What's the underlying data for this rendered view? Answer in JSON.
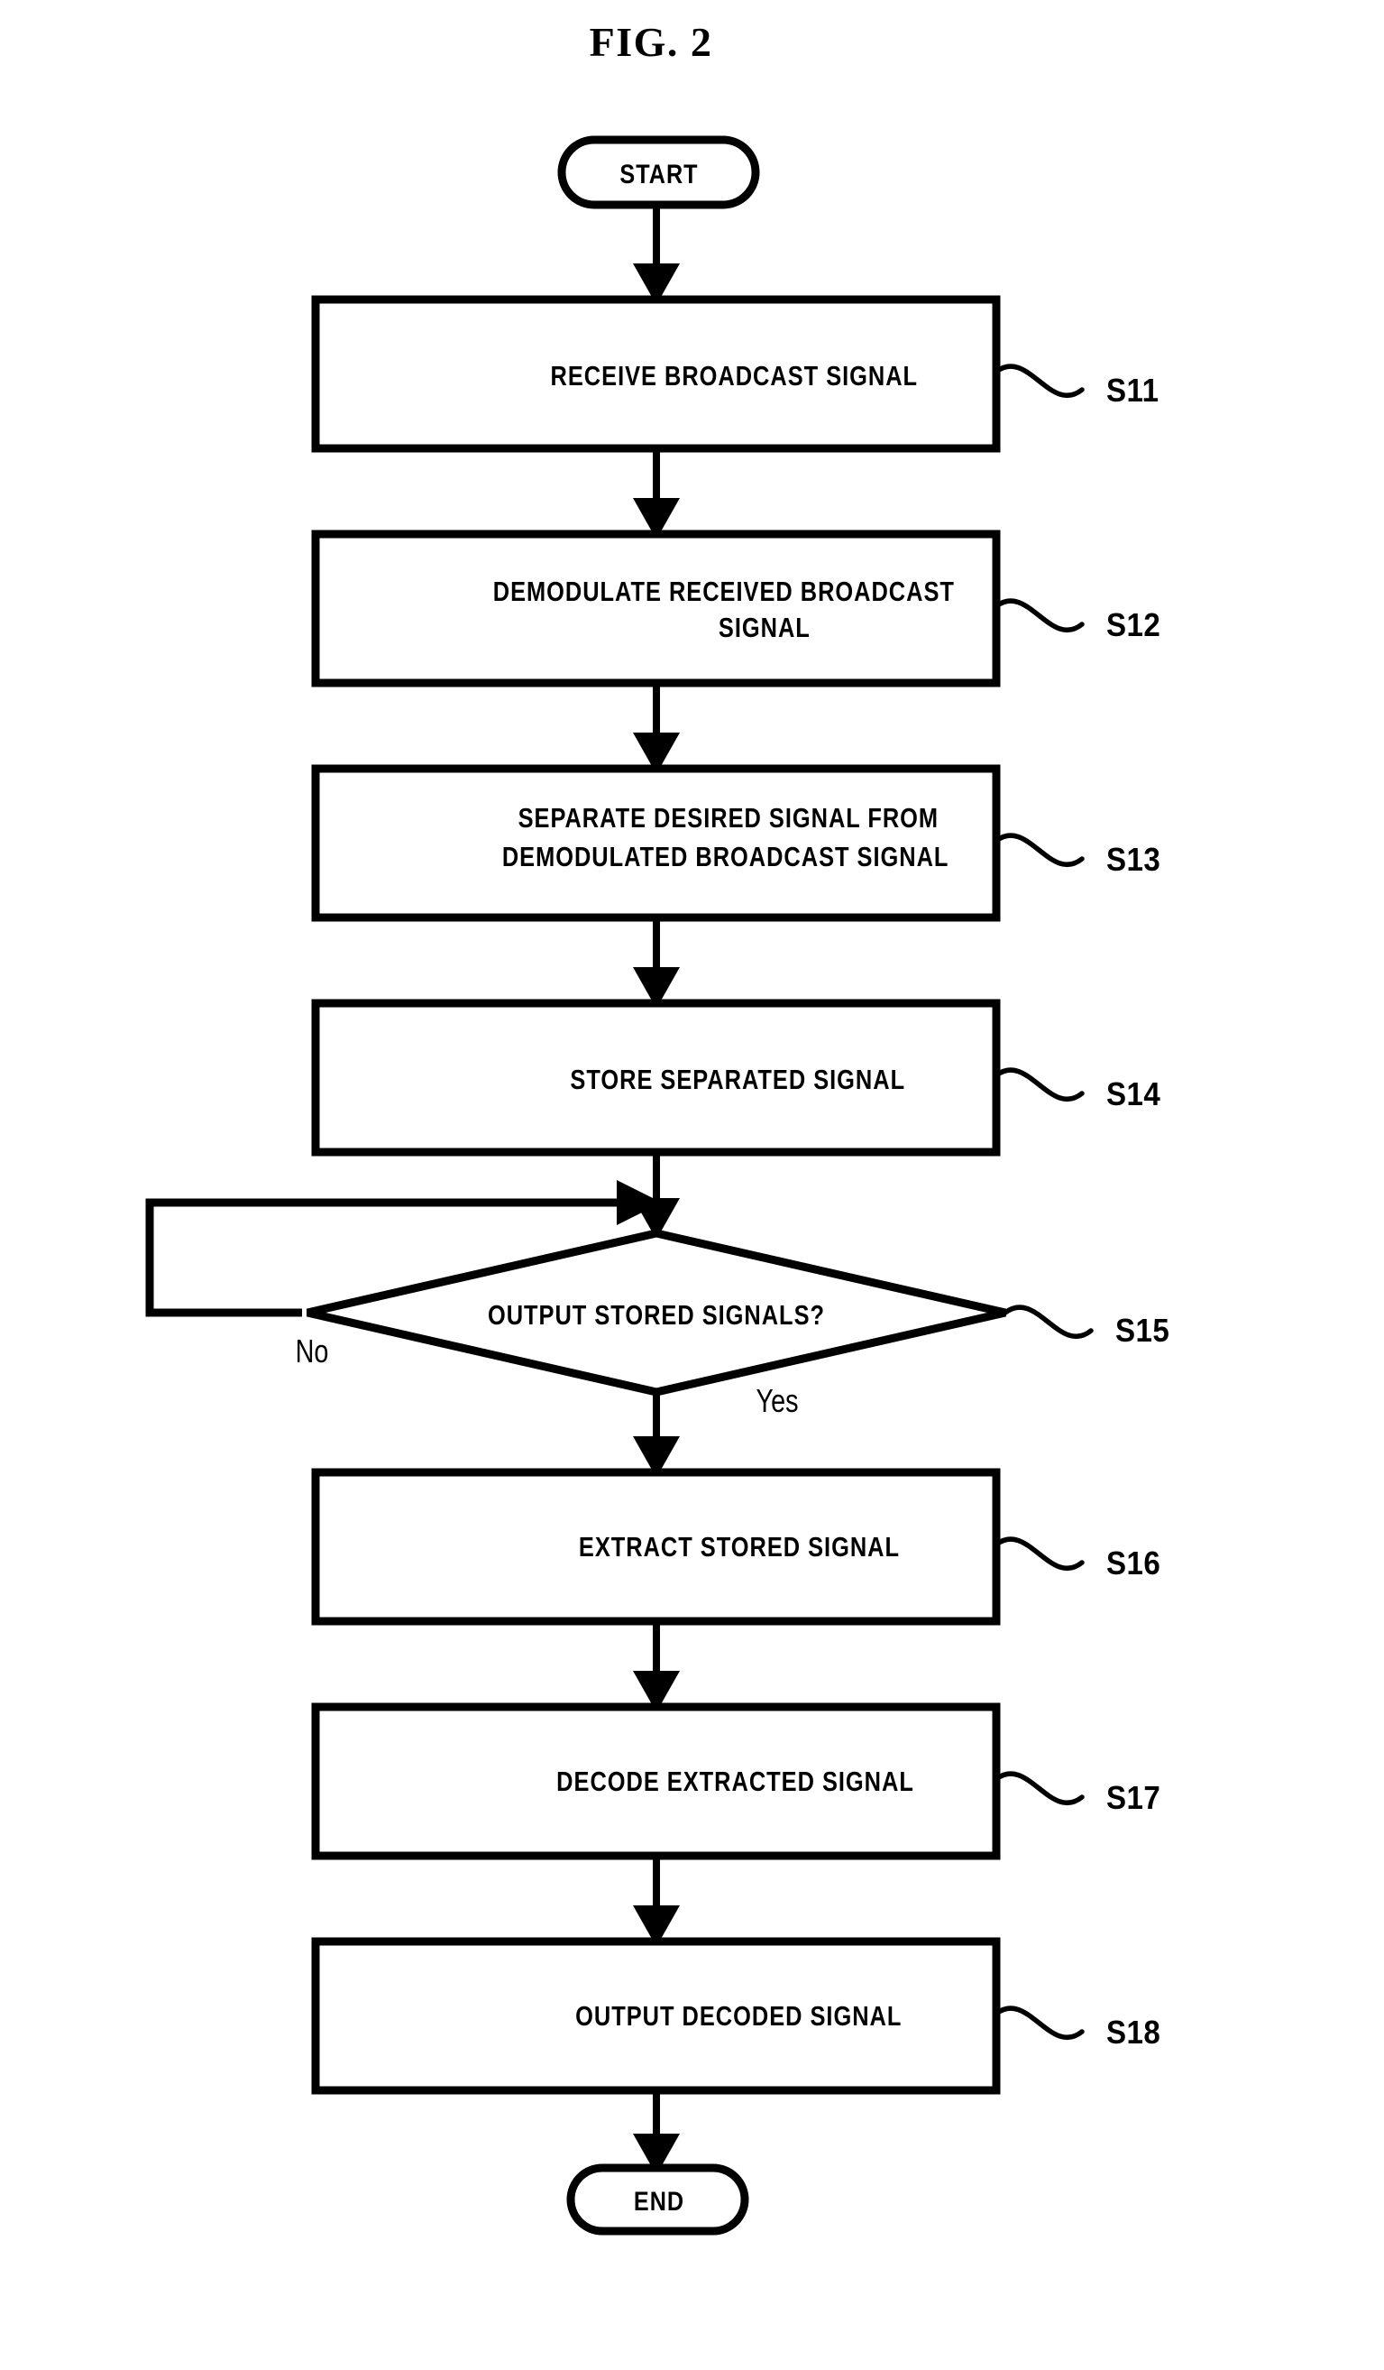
{
  "figure": {
    "title": "FIG. 2",
    "type": "patent-flowchart"
  },
  "terminators": {
    "start": "START",
    "end": "END"
  },
  "steps": [
    {
      "ref": "S11",
      "lines": [
        "RECEIVE BROADCAST SIGNAL"
      ]
    },
    {
      "ref": "S12",
      "lines": [
        "DEMODULATE RECEIVED BROADCAST",
        "SIGNAL"
      ]
    },
    {
      "ref": "S13",
      "lines": [
        "SEPARATE DESIRED SIGNAL FROM",
        "DEMODULATED BROADCAST SIGNAL"
      ]
    },
    {
      "ref": "S14",
      "lines": [
        "STORE SEPARATED SIGNAL"
      ]
    },
    {
      "ref": "S16",
      "lines": [
        "EXTRACT STORED SIGNAL"
      ]
    },
    {
      "ref": "S17",
      "lines": [
        "DECODE EXTRACTED SIGNAL"
      ]
    },
    {
      "ref": "S18",
      "lines": [
        "OUTPUT DECODED SIGNAL"
      ]
    }
  ],
  "decision": {
    "ref": "S15",
    "text": "OUTPUT STORED SIGNALS?",
    "branch_no": "No",
    "branch_yes": "Yes"
  },
  "colors": {
    "ink": "#000000",
    "paper": "#ffffff"
  }
}
